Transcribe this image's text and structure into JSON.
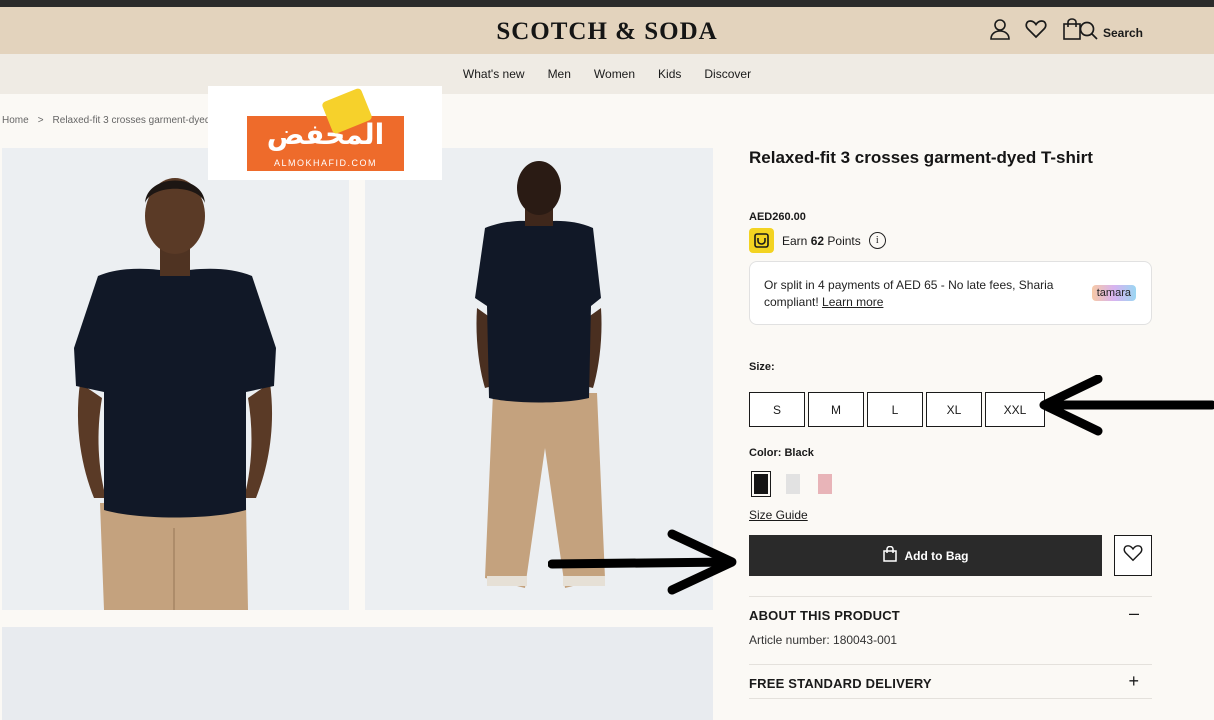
{
  "header": {
    "logo": "SCOTCH & SODA",
    "search_label": "Search",
    "icons": [
      "account-icon",
      "heart-icon",
      "bag-icon",
      "search-icon"
    ]
  },
  "nav": {
    "items": [
      "What's new",
      "Men",
      "Women",
      "Kids",
      "Discover"
    ]
  },
  "breadcrumb": {
    "home": "Home",
    "separator": ">",
    "current": "Relaxed-fit 3 crosses garment-dyed"
  },
  "promo": {
    "arabic": "المخفض",
    "english": "ALMOKHAFID.COM"
  },
  "product": {
    "title": "Relaxed-fit 3 crosses garment-dyed T-shirt",
    "price": "AED260.00",
    "points_prefix": "Earn",
    "points_value": "62",
    "points_suffix": "Points",
    "info_symbol": "i"
  },
  "tamara": {
    "text": "Or split in 4 payments of AED 65 - No late fees, Sharia compliant!",
    "link": "Learn more",
    "badge": "tamara"
  },
  "size": {
    "label": "Size:",
    "options": [
      "S",
      "M",
      "L",
      "XL",
      "XXL"
    ]
  },
  "color": {
    "label": "Color:",
    "selected": "Black",
    "swatches": [
      "#151515",
      "#e2e2e2",
      "#e8b4b8"
    ]
  },
  "size_guide": "Size Guide",
  "add_to_bag": "Add to Bag",
  "accordion": {
    "about_title": "ABOUT THIS PRODUCT",
    "about_toggle": "–",
    "article": "Article number: 180043-001",
    "delivery_title": "FREE STANDARD DELIVERY",
    "delivery_toggle": "+"
  },
  "colors": {
    "header_bg": "#e3d3bd",
    "nav_bg": "#efebe4",
    "button_bg": "#2a2a2a",
    "promo_orange": "#ee6b2b"
  }
}
